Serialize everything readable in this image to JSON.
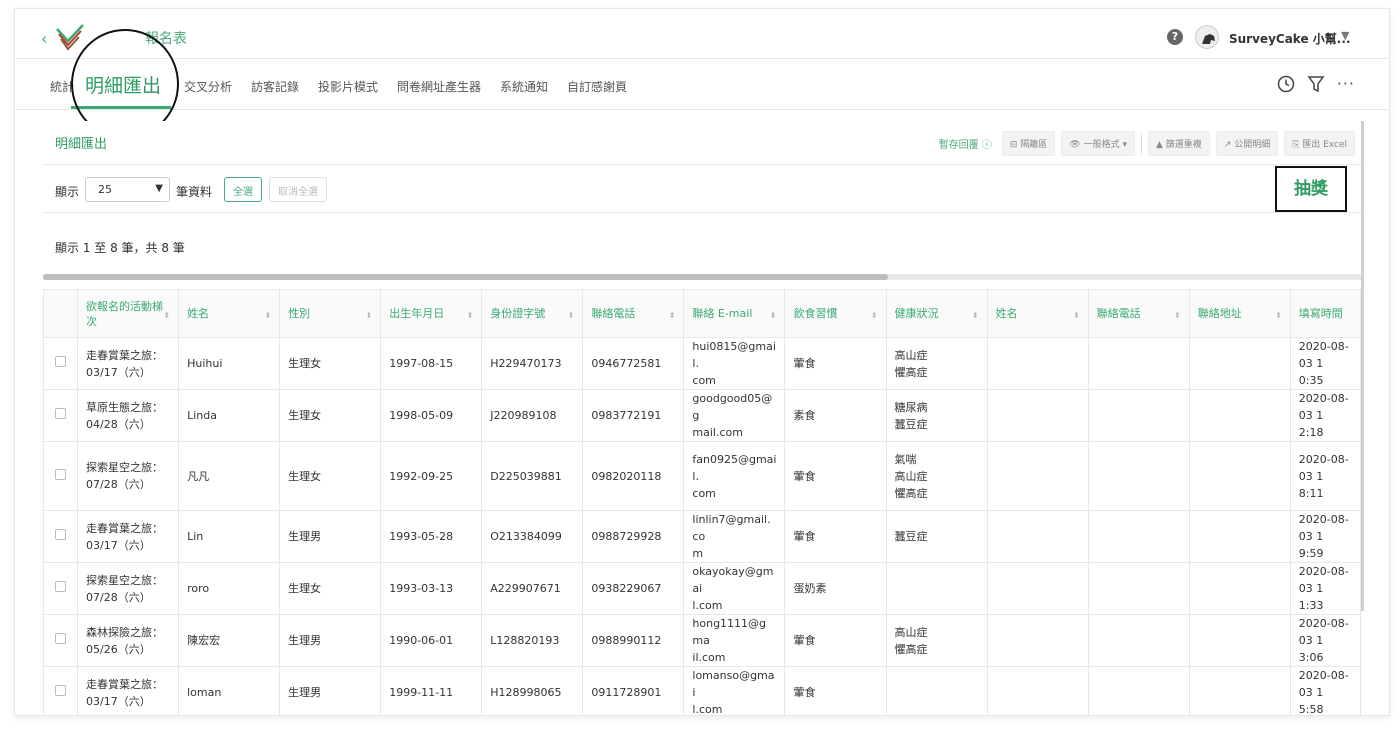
{
  "header": {
    "back_icon": "chevron-left-icon",
    "survey_title": "報名表",
    "user_name": "SurveyCake 小幫...",
    "help_label": "?"
  },
  "nav": {
    "tabs": [
      {
        "label": "統計"
      },
      {
        "label": "明細匯出"
      },
      {
        "label": "交叉分析"
      },
      {
        "label": "訪客記錄"
      },
      {
        "label": "投影片模式"
      },
      {
        "label": "問卷網址產生器"
      },
      {
        "label": "系統通知"
      },
      {
        "label": "自訂感謝頁"
      }
    ],
    "more_label": "···"
  },
  "panel": {
    "title": "明細匯出",
    "save_replay": "暫存回覆",
    "tools": [
      "隔離區",
      "一般格式",
      "篩選重複",
      "公開明細",
      "匯出 Excel"
    ]
  },
  "controls": {
    "show_label": "顯示",
    "page_size": "25",
    "records_label": "筆資料",
    "select_all": "全選",
    "deselect_all": "取消全選",
    "lottery": "抽獎",
    "summary": "顯示 1 至 8 筆，共 8 筆"
  },
  "table": {
    "columns": [
      "欲報名的活動梯次",
      "姓名",
      "性別",
      "出生年月日",
      "身份證字號",
      "聯絡電話",
      "聯絡 E-mail",
      "飲食習慣",
      "健康狀況",
      "姓名",
      "聯絡電話",
      "聯絡地址",
      "填寫時間"
    ],
    "rows": [
      [
        "走春賞葉之旅：\n03/17（六）",
        "Huihui",
        "生理女",
        "1997-08-15",
        "H229470173",
        "0946772581",
        "hui0815@gmail.\ncom",
        "葷食",
        "高山症\n懼高症",
        "",
        "",
        "",
        "2020-08-03 1\n0:35"
      ],
      [
        "草原生態之旅：\n04/28（六）",
        "Linda",
        "生理女",
        "1998-05-09",
        "J220989108",
        "0983772191",
        "goodgood05@g\nmail.com",
        "素食",
        "糖尿病\n蠶豆症",
        "",
        "",
        "",
        "2020-08-03 1\n2:18"
      ],
      [
        "探索星空之旅：\n07/28（六）",
        "凡凡",
        "生理女",
        "1992-09-25",
        "D225039881",
        "0982020118",
        "fan0925@gmail.\ncom",
        "葷食",
        "氣喘\n高山症\n懼高症",
        "",
        "",
        "",
        "2020-08-03 1\n8:11"
      ],
      [
        "走春賞葉之旅：\n03/17（六）",
        "Lin",
        "生理男",
        "1993-05-28",
        "O213384099",
        "0988729928",
        "linlin7@gmail.co\nm",
        "葷食",
        "蠶豆症",
        "",
        "",
        "",
        "2020-08-03 1\n9:59"
      ],
      [
        "探索星空之旅：\n07/28（六）",
        "roro",
        "生理女",
        "1993-03-13",
        "A229907671",
        "0938229067",
        "okayokay@gmai\nl.com",
        "蛋奶素",
        "",
        "",
        "",
        "",
        "2020-08-03 1\n1:33"
      ],
      [
        "森林探險之旅：\n05/26（六）",
        "陳宏宏",
        "生理男",
        "1990-06-01",
        "L128820193",
        "0988990112",
        "hong1111@gma\nil.com",
        "葷食",
        "高山症\n懼高症",
        "",
        "",
        "",
        "2020-08-03 1\n3:06"
      ],
      [
        "走春賞葉之旅：\n03/17（六）",
        "loman",
        "生理男",
        "1999-11-11",
        "H128998065",
        "0911728901",
        "lomanso@gmai\nl.com",
        "葷食",
        "",
        "",
        "",
        "",
        "2020-08-03 1\n5:58"
      ]
    ]
  },
  "colors": {
    "accent": "#2e9b63",
    "accent_light": "#4aa87a"
  }
}
